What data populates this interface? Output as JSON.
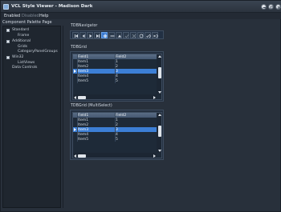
{
  "window": {
    "title": "VCL Style Viewer - Madison Dark"
  },
  "menu": {
    "items": [
      "Enabled",
      "Disabled",
      "Help"
    ]
  },
  "palette": {
    "header": "Component Palette Page",
    "items": [
      {
        "label": "Standard",
        "level": 0,
        "box": true
      },
      {
        "label": "Frame",
        "level": 1,
        "box": false
      },
      {
        "label": "Additional",
        "level": 0,
        "box": true
      },
      {
        "label": "Grids",
        "level": 1,
        "box": false
      },
      {
        "label": "CategoryPanelGroups",
        "level": 1,
        "box": false
      },
      {
        "label": "Win32",
        "level": 0,
        "box": true
      },
      {
        "label": "ListViews",
        "level": 1,
        "box": false
      },
      {
        "label": "Data Controls",
        "level": 0,
        "box": false
      }
    ]
  },
  "navigator": {
    "label": "TDBNavigator",
    "buttons": [
      "first-icon",
      "prior-icon",
      "next-icon",
      "last-icon",
      "insert-icon",
      "delete-icon",
      "edit-icon",
      "post-icon",
      "cancel-icon",
      "refresh-icon",
      "apply-updates-icon",
      "cancel-updates-icon"
    ]
  },
  "grid1": {
    "label": "TDBGrid",
    "columns": [
      "Field1",
      "Field2"
    ],
    "rows": [
      [
        "Item1",
        "1"
      ],
      [
        "Item2",
        "2"
      ],
      [
        "Item3",
        "3"
      ],
      [
        "Item4",
        "4"
      ],
      [
        "Item5",
        "5"
      ]
    ],
    "selected": 2
  },
  "grid2": {
    "label": "TDBGrid (MultiSelect)",
    "columns": [
      "Field1",
      "Field2"
    ],
    "rows": [
      [
        "Item1",
        "1"
      ],
      [
        "Item2",
        "2"
      ],
      [
        "Item3",
        "3"
      ],
      [
        "Item4",
        "4"
      ],
      [
        "Item5",
        "5"
      ]
    ],
    "selected": 2
  },
  "colors": {
    "accent": "#3c7fd6",
    "background": "#28303b",
    "panel": "#243040"
  }
}
